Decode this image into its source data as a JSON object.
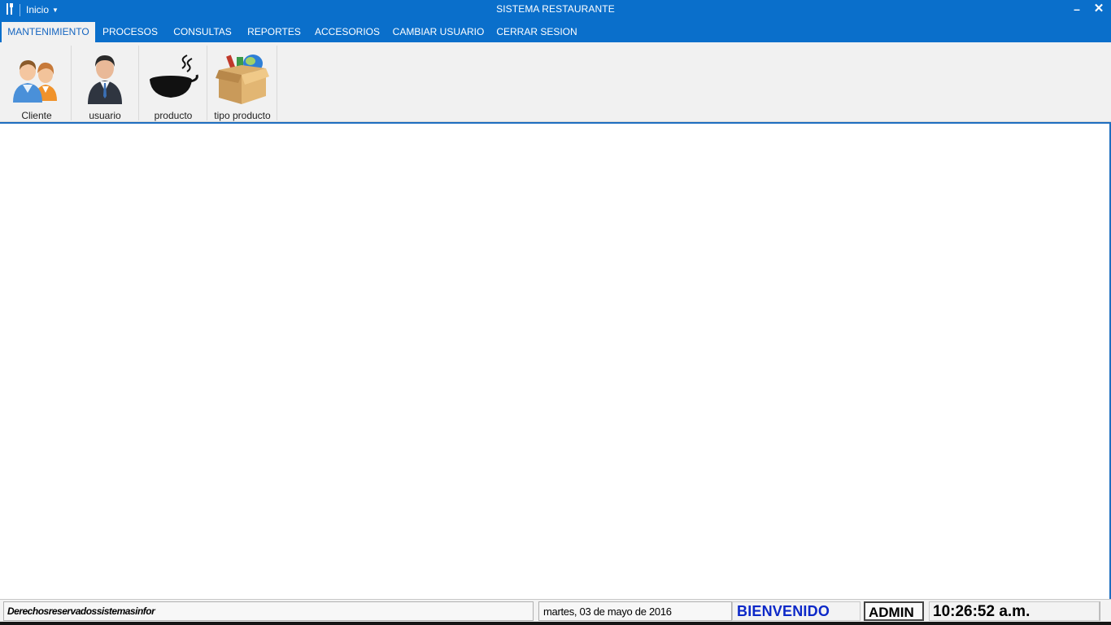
{
  "titlebar": {
    "quick_menu_label": "Inicio",
    "title": "SISTEMA RESTAURANTE",
    "minimize_glyph": "–",
    "close_glyph": "✕"
  },
  "tabs": [
    {
      "label": "MANTENIMIENTO",
      "active": true
    },
    {
      "label": "PROCESOS",
      "active": false
    },
    {
      "label": "CONSULTAS",
      "active": false
    },
    {
      "label": "REPORTES",
      "active": false
    },
    {
      "label": "ACCESORIOS",
      "active": false
    },
    {
      "label": "CAMBIAR USUARIO",
      "active": false
    },
    {
      "label": "CERRAR SESION",
      "active": false
    }
  ],
  "ribbon": {
    "buttons": [
      {
        "label": "Cliente",
        "icon": "people-icon"
      },
      {
        "label": "usuario",
        "icon": "businessman-icon"
      },
      {
        "label": "producto",
        "icon": "soup-bowl-icon"
      },
      {
        "label": "tipo producto",
        "icon": "product-box-icon"
      }
    ]
  },
  "statusbar": {
    "copyright": "Derechosreservadossistemasinfor",
    "date": "martes, 03 de mayo de 2016",
    "welcome": "BIENVENIDO",
    "user": "ADMIN",
    "clock": "10:26:52 a.m."
  },
  "colors": {
    "accent": "#0a6fcb",
    "active_tab_text": "#1565c0",
    "welcome_text": "#0c28c8"
  }
}
